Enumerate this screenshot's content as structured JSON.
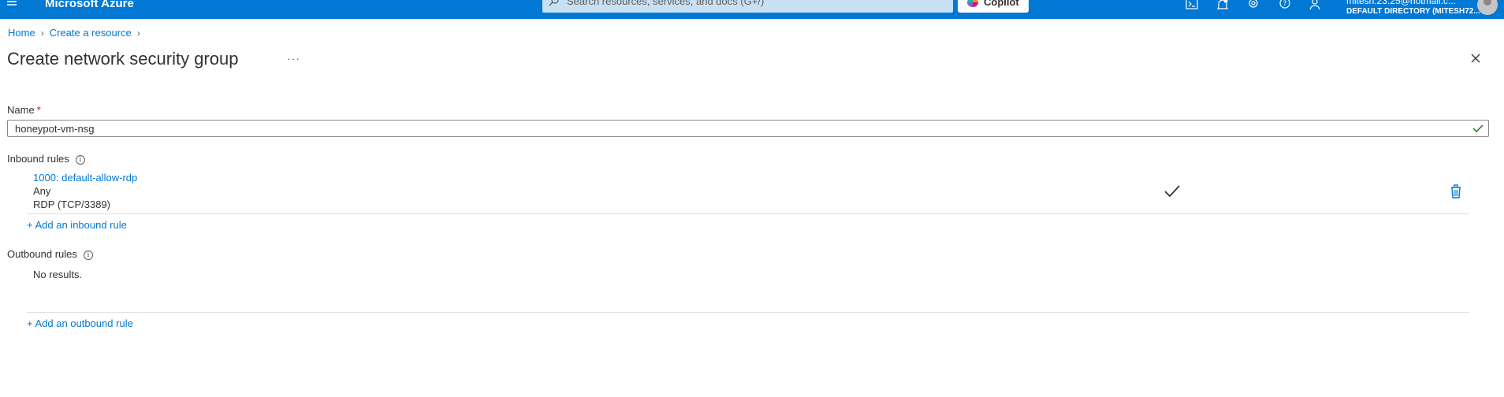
{
  "topbar": {
    "brand": "Microsoft Azure",
    "search_placeholder": "Search resources, services, and docs (G+/)",
    "copilot_label": "Copilot",
    "user_email": "mitesh.23.25@hotmail.c...",
    "user_directory": "DEFAULT DIRECTORY (MITESH72..."
  },
  "breadcrumb": {
    "items": [
      "Home",
      "Create a resource"
    ]
  },
  "page": {
    "title": "Create network security group",
    "more_label": "···"
  },
  "form": {
    "name_label": "Name",
    "name_required_mark": "*",
    "name_value": "honeypot-vm-nsg",
    "inbound_label": "Inbound rules",
    "inbound_rules": [
      {
        "title": "1000: default-allow-rdp",
        "source": "Any",
        "service": "RDP (TCP/3389)"
      }
    ],
    "add_inbound_label": "+ Add an inbound rule",
    "outbound_label": "Outbound rules",
    "outbound_empty": "No results.",
    "add_outbound_label": "+ Add an outbound rule"
  },
  "colors": {
    "azure_blue": "#0078d4",
    "valid_green": "#107c10",
    "required_red": "#a4262c"
  }
}
